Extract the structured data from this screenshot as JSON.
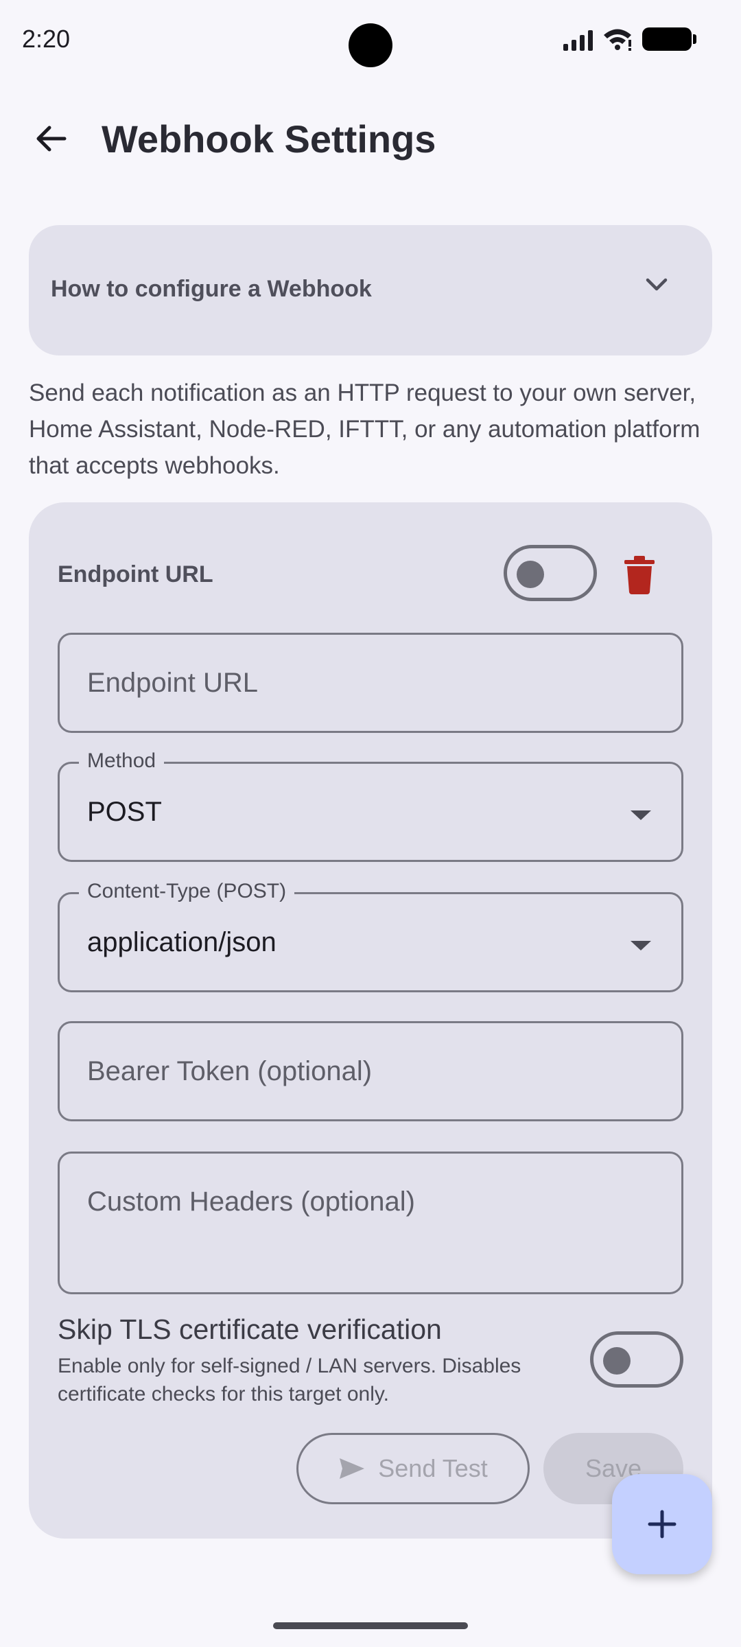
{
  "status_bar": {
    "time": "2:20"
  },
  "app_bar": {
    "title": "Webhook Settings"
  },
  "how_to": {
    "title": "How to configure a Webhook"
  },
  "description": "Send each notification as an HTTP request to your own server, Home Assistant, Node-RED, IFTTT, or any automation platform that accepts webhooks.",
  "card": {
    "title": "Endpoint URL",
    "enabled": false,
    "url_field": {
      "placeholder": "Endpoint URL",
      "value": ""
    },
    "method_field": {
      "label": "Method",
      "value": "POST"
    },
    "content_type_field": {
      "label": "Content-Type (POST)",
      "value": "application/json"
    },
    "bearer_field": {
      "placeholder": "Bearer Token (optional)",
      "value": ""
    },
    "headers_field": {
      "placeholder": "Custom Headers (optional)",
      "value": ""
    },
    "tls": {
      "title": "Skip TLS certificate verification",
      "subtitle": "Enable only for self-signed / LAN servers. Disables certificate checks for this target only.",
      "enabled": false
    },
    "send_test_label": "Send Test",
    "save_label": "Save"
  },
  "colors": {
    "accent_danger": "#b3261e",
    "fab_bg": "#c4d0ff",
    "card_bg": "#e2e1ec"
  }
}
